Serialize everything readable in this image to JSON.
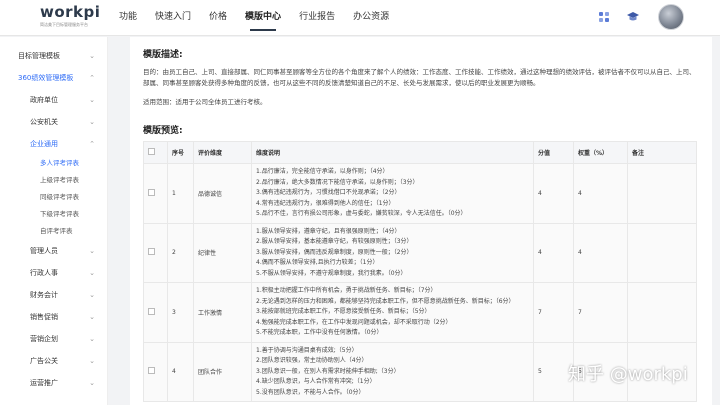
{
  "header": {
    "logo_text": "workpi",
    "logo_subtitle": "简洁美下目标管理服务平台",
    "nav": [
      {
        "label": "功能",
        "active": false
      },
      {
        "label": "快速入门",
        "active": false
      },
      {
        "label": "价格",
        "active": false
      },
      {
        "label": "模版中心",
        "active": true
      },
      {
        "label": "行业报告",
        "active": false
      },
      {
        "label": "办公资源",
        "active": false
      }
    ],
    "icons": [
      "grid-icon",
      "graduation-cap-icon"
    ]
  },
  "sidebar": {
    "items": [
      {
        "label": "目标管理模板",
        "level": 0,
        "chevron": "⌄",
        "state": ""
      },
      {
        "label": "360绩效管理模板",
        "level": 0,
        "chevron": "⌃",
        "state": "open"
      },
      {
        "label": "政府单位",
        "level": 1,
        "chevron": "⌄",
        "state": ""
      },
      {
        "label": "公安机关",
        "level": 1,
        "chevron": "⌄",
        "state": ""
      },
      {
        "label": "企业通用",
        "level": 1,
        "chevron": "⌃",
        "state": "open"
      },
      {
        "label": "多人评考评表",
        "level": 2,
        "chevron": "",
        "state": "active"
      },
      {
        "label": "上级评考评表",
        "level": 2,
        "chevron": "",
        "state": ""
      },
      {
        "label": "同级评考评表",
        "level": 2,
        "chevron": "",
        "state": ""
      },
      {
        "label": "下级评考评表",
        "level": 2,
        "chevron": "",
        "state": ""
      },
      {
        "label": "自评考评表",
        "level": 2,
        "chevron": "",
        "state": ""
      },
      {
        "label": "管理人员",
        "level": 1,
        "chevron": "⌄",
        "state": ""
      },
      {
        "label": "行政人事",
        "level": 1,
        "chevron": "⌄",
        "state": ""
      },
      {
        "label": "财务会计",
        "level": 1,
        "chevron": "⌄",
        "state": ""
      },
      {
        "label": "销售促销",
        "level": 1,
        "chevron": "⌄",
        "state": ""
      },
      {
        "label": "营销企划",
        "level": 1,
        "chevron": "⌄",
        "state": ""
      },
      {
        "label": "广告公关",
        "level": 1,
        "chevron": "⌄",
        "state": ""
      },
      {
        "label": "运营推广",
        "level": 1,
        "chevron": "⌄",
        "state": ""
      }
    ]
  },
  "main": {
    "desc_title": "模版描述:",
    "desc_text": "目的：由员工自己、上司、直接部属、同仁同事甚至顾客等全方位的各个角度来了解个人的绩效：工作态度、工作技能、工作绩效，通过这种理想的绩效评估，被评估者不仅可以从自己、上司、部属、同事甚至顾客处获得多种角度的反馈，也可从这些不同的反馈清楚知道自己的不足、长处与发展需求，使以后的职业发展更为顺畅。",
    "scope_text": "适用范围：适用于公司全体员工进行考核。",
    "preview_title": "模版预览:",
    "table": {
      "headers": [
        "",
        "序号",
        "评价维度",
        "维度说明",
        "分值",
        "权重（%）",
        "备注"
      ],
      "rows": [
        {
          "no": "1",
          "dimension": "品德诚信",
          "lines": [
            "1.品行廉洁，完全能信守承诺，以身作则；（4分）",
            "2.品行廉洁，绝大多数情况下能信守承诺，以身作则；（3分）",
            "3.偶有违纪违规行为，习惯找借口不兑现承诺；（2分）",
            "4.常有违纪违规行为，很难得到他人的信任；（1分）",
            "5.品行不佳，言行有损公司形象，虚与委蛇，嫌贫较深，令人无法信任。（0分）"
          ],
          "score": "4",
          "weight": "4",
          "note": ""
        },
        {
          "no": "2",
          "dimension": "纪律性",
          "lines": [
            "1.服从领导安排，遵章守纪，且有很强原则性；（4分）",
            "2.服从领导安排，基本能遵章守纪，有较强原则性；（3分）",
            "3.服从领导安排，偶而违反规章制度，原则性一般；（2分）",
            "4.偶而不服从领导安排,且执行力较差；（1分）",
            "5.不服从领导安排，不遵守规章制度，我行我素。（0分）"
          ],
          "score": "4",
          "weight": "4",
          "note": ""
        },
        {
          "no": "3",
          "dimension": "工作激情",
          "lines": [
            "1.积极主动把握工作中所有机会，勇于挑战新任务、新目标；（7分）",
            "2.无论遇到怎样的压力和困难，都能够坚持完成本职工作，但不愿意挑战新任务、新目标；（6分）",
            "3.能按部就班完成本职工作，不愿意接受新任务、新目标；（5分）",
            "4.勉强能完成本职工作，在工作中发现问题或机会，却不采取行动（2分）",
            "5.不能完成本职，工作中没有任何激情。（0分）"
          ],
          "score": "7",
          "weight": "7",
          "note": ""
        },
        {
          "no": "4",
          "dimension": "团队合作",
          "lines": [
            "1.善于协调与沟通目桌有成效;（5分）",
            "2.团队意识较强，常主动协助别人（4分）",
            "3.团队意识一般，在别人有需求时能伸手相助;（3分）",
            "4.缺少团队意识，与人合作常有冲突;（1分）",
            "5.没有团队意识，不能与人合作。（0分）"
          ],
          "score": "5",
          "weight": "5",
          "note": ""
        }
      ]
    }
  },
  "watermark": "知乎 @workpi"
}
